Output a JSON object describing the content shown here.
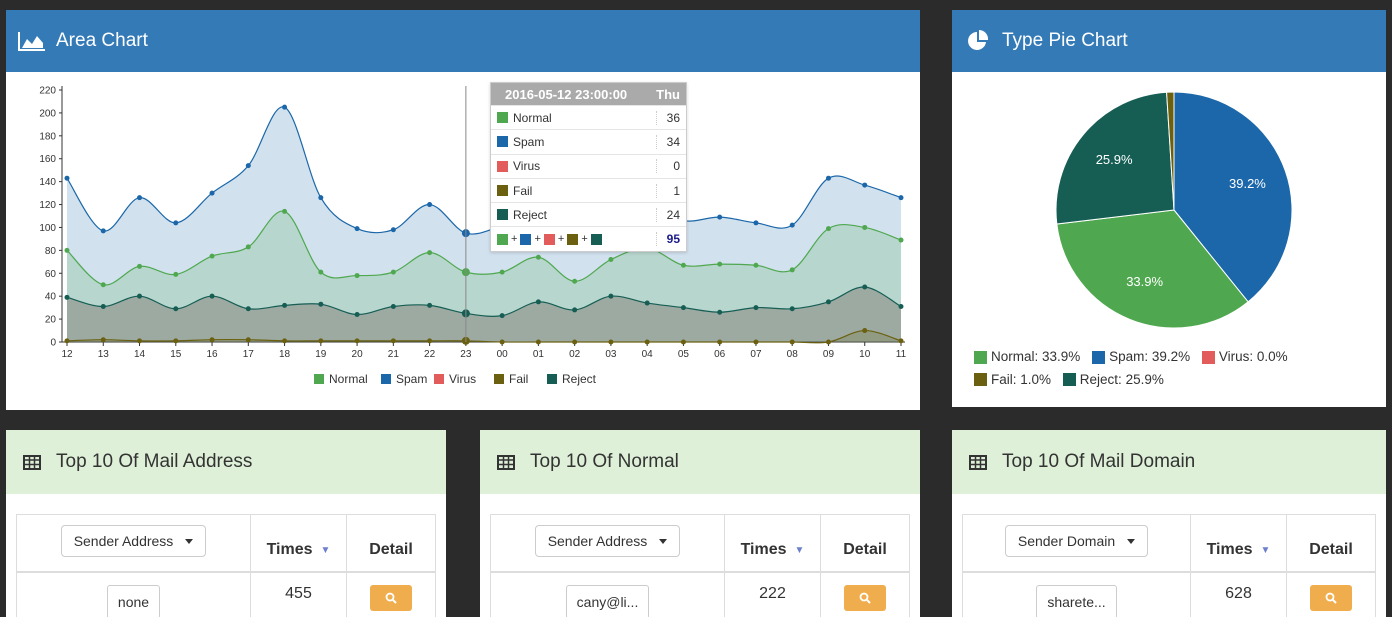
{
  "area_panel": {
    "title": "Area Chart"
  },
  "pie_panel": {
    "title": "Type Pie Chart"
  },
  "colors": {
    "normal": "#4fa84f",
    "spam": "#1b67a9",
    "virus": "#e25c5c",
    "fail": "#6b6010",
    "reject": "#165e54",
    "header_blue": "#337ab7",
    "detail_orange": "#f0ad4e"
  },
  "tooltip": {
    "title": "2016-05-12 23:00:00",
    "day": "Thu",
    "rows": [
      {
        "name": "Normal",
        "value": "36"
      },
      {
        "name": "Spam",
        "value": "34"
      },
      {
        "name": "Virus",
        "value": "0"
      },
      {
        "name": "Fail",
        "value": "1"
      },
      {
        "name": "Reject",
        "value": "24"
      }
    ],
    "plus": "+",
    "sum": "95"
  },
  "chart_data": [
    {
      "type": "area",
      "stacked": true,
      "categories": [
        "12",
        "13",
        "14",
        "15",
        "16",
        "17",
        "18",
        "19",
        "20",
        "21",
        "22",
        "23",
        "00",
        "01",
        "02",
        "03",
        "04",
        "05",
        "06",
        "07",
        "08",
        "09",
        "10",
        "11"
      ],
      "ylim": [
        0,
        220
      ],
      "yticks": [
        0,
        20,
        40,
        60,
        80,
        100,
        120,
        140,
        160,
        180,
        200,
        220
      ],
      "legend": [
        "Normal",
        "Spam",
        "Virus",
        "Fail",
        "Reject"
      ],
      "legend_position": "bottom",
      "series": [
        {
          "name": "Fail",
          "values": [
            1,
            2,
            1,
            1,
            2,
            2,
            1,
            1,
            1,
            1,
            1,
            1,
            0,
            0,
            0,
            0,
            0,
            0,
            0,
            0,
            0,
            0,
            10,
            1
          ]
        },
        {
          "name": "Reject",
          "values": [
            38,
            29,
            39,
            28,
            38,
            27,
            31,
            32,
            23,
            30,
            31,
            24,
            23,
            35,
            28,
            40,
            34,
            30,
            26,
            30,
            29,
            35,
            38,
            30
          ]
        },
        {
          "name": "Virus",
          "values": [
            0,
            0,
            0,
            0,
            0,
            0,
            0,
            0,
            0,
            0,
            0,
            0,
            0,
            0,
            0,
            0,
            0,
            0,
            0,
            0,
            0,
            0,
            0,
            0
          ]
        },
        {
          "name": "Normal",
          "values": [
            41,
            19,
            26,
            30,
            35,
            54,
            82,
            28,
            34,
            30,
            46,
            36,
            38,
            39,
            25,
            32,
            48,
            37,
            42,
            37,
            34,
            64,
            52,
            58
          ]
        },
        {
          "name": "Spam",
          "values": [
            63,
            47,
            60,
            45,
            55,
            71,
            91,
            65,
            41,
            37,
            42,
            34,
            40,
            33,
            38,
            36,
            39,
            39,
            41,
            37,
            39,
            44,
            37,
            37
          ]
        }
      ]
    },
    {
      "type": "pie",
      "slices": [
        {
          "name": "Normal",
          "value": 33.9,
          "label": "33.9%"
        },
        {
          "name": "Spam",
          "value": 39.2,
          "label": "39.2%"
        },
        {
          "name": "Virus",
          "value": 0.0,
          "label": ""
        },
        {
          "name": "Fail",
          "value": 1.0,
          "label": ""
        },
        {
          "name": "Reject",
          "value": 25.9,
          "label": "25.9%"
        }
      ],
      "legend": [
        "Normal: 33.9%",
        "Spam: 39.2%",
        "Virus: 0.0%",
        "Fail: 1.0%",
        "Reject: 25.9%"
      ]
    }
  ],
  "tables": [
    {
      "title": "Top 10 Of Mail Address",
      "dropdown": "Sender Address",
      "times_label": "Times",
      "detail_label": "Detail",
      "rows": [
        {
          "value": "none",
          "times": "455"
        }
      ]
    },
    {
      "title": "Top 10 Of Normal",
      "dropdown": "Sender Address",
      "times_label": "Times",
      "detail_label": "Detail",
      "rows": [
        {
          "value": "cany@li...",
          "times": "222"
        }
      ]
    },
    {
      "title": "Top 10 Of Mail Domain",
      "dropdown": "Sender Domain",
      "times_label": "Times",
      "detail_label": "Detail",
      "rows": [
        {
          "value": "sharete...",
          "times": "628"
        }
      ]
    }
  ]
}
